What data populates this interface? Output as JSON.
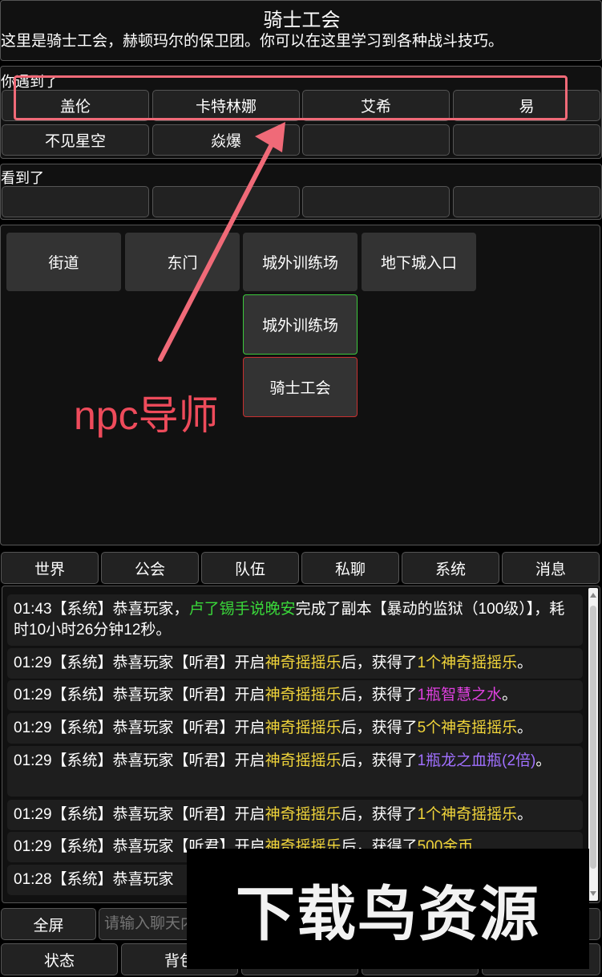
{
  "header": {
    "title": "骑士工会",
    "description": "这里是骑士工会，赫顿玛尔的保卫团。你可以在这里学习到各种战斗技巧。"
  },
  "met": {
    "label": "你遇到了",
    "npcs": [
      "盖伦",
      "卡特林娜",
      "艾希",
      "易",
      "不见星空",
      "焱爆",
      "",
      ""
    ]
  },
  "seen": {
    "label": "看到了",
    "items": [
      "",
      "",
      "",
      ""
    ]
  },
  "map": {
    "row1": [
      "街道",
      "东门",
      "城外训练场",
      "地下城入口"
    ],
    "north": "城外训练场",
    "current": "骑士工会"
  },
  "annotation": {
    "text": "npc导师",
    "color": "#ee4b5b"
  },
  "chat_tabs": [
    "世界",
    "公会",
    "队伍",
    "私聊",
    "系统",
    "消息"
  ],
  "messages": [
    {
      "time": "01:43",
      "pre": "【系统】恭喜玩家，",
      "hl1": "卢了锡手说晚安",
      "hl1_color": "#3ad93a",
      "mid": "完成了副本【暴动的监狱（100级）】，耗时10小时26分钟12秒。",
      "hl2": "",
      "hl2_color": "",
      "post": ""
    },
    {
      "time": "01:29",
      "pre": "【系统】恭喜玩家【听君】开启",
      "hl1": "神奇摇摇乐",
      "hl1_color": "#f0d43a",
      "mid": "后，获得了",
      "hl2": "1个神奇摇摇乐",
      "hl2_color": "#f0d43a",
      "post": "。"
    },
    {
      "time": "01:29",
      "pre": "【系统】恭喜玩家【听君】开启",
      "hl1": "神奇摇摇乐",
      "hl1_color": "#f0d43a",
      "mid": "后，获得了",
      "hl2": "1瓶智慧之水",
      "hl2_color": "#e040e0",
      "post": "。"
    },
    {
      "time": "01:29",
      "pre": "【系统】恭喜玩家【听君】开启",
      "hl1": "神奇摇摇乐",
      "hl1_color": "#f0d43a",
      "mid": "后，获得了",
      "hl2": "5个神奇摇摇乐",
      "hl2_color": "#f0d43a",
      "post": "。"
    },
    {
      "time": "01:29",
      "pre": "【系统】恭喜玩家【听君】开启",
      "hl1": "神奇摇摇乐",
      "hl1_color": "#f0d43a",
      "mid": "后，获得了",
      "hl2": "1瓶龙之血瓶(2倍)",
      "hl2_color": "#a070ff",
      "post": "。"
    },
    {
      "time": "01:29",
      "pre": "【系统】恭喜玩家【听君】开启",
      "hl1": "神奇摇摇乐",
      "hl1_color": "#f0d43a",
      "mid": "后，获得了",
      "hl2": "1个神奇摇摇乐",
      "hl2_color": "#f0d43a",
      "post": "。"
    },
    {
      "time": "01:29",
      "pre": "【系统】恭喜玩家【听君】开启",
      "hl1": "神奇摇摇乐",
      "hl1_color": "#f0d43a",
      "mid": "后，获得了",
      "hl2": "500金币",
      "hl2_color": "#f0d43a",
      "post": ""
    },
    {
      "time": "01:28",
      "pre": "【系统】恭喜玩家",
      "hl1": "",
      "hl1_color": "",
      "mid": "",
      "hl2": "",
      "hl2_color": "",
      "post": ""
    }
  ],
  "chat_input": {
    "fullscreen_label": "全屏",
    "placeholder": "请输入聊天内容"
  },
  "bottom_nav": [
    "状态",
    "背包",
    "",
    "",
    ""
  ],
  "watermark": {
    "text": "下载鸟资源"
  }
}
